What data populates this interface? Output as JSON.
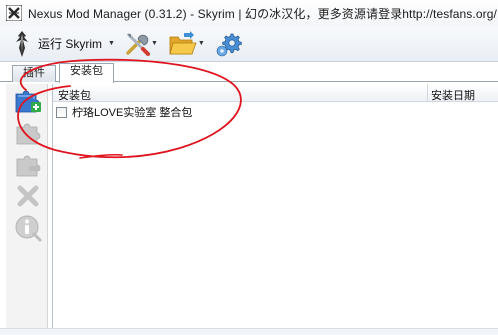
{
  "window": {
    "title": "Nexus Mod Manager (0.31.2) - Skyrim | 幻の冰汉化，更多资源请登录http://tesfans.org/"
  },
  "toolbar": {
    "game_label": "运行 Skyrim",
    "icons": [
      "skyrim-logo",
      "tools-icon",
      "folder-icon",
      "settings-icon"
    ]
  },
  "tabs": [
    {
      "label": "插件",
      "active": false
    },
    {
      "label": "安装包",
      "active": true
    }
  ],
  "actions": [
    "add-mod",
    "activate-mod",
    "deactivate-mod",
    "delete-mod",
    "mod-info"
  ],
  "list": {
    "columns": [
      "安装包",
      "安装日期"
    ],
    "rows": [
      {
        "name": "柠珞LOVE实验室 整合包",
        "checked": false,
        "date": ""
      }
    ]
  },
  "colors": {
    "annotation": "#e0141e",
    "toolbar_bg": "#edf1f6",
    "tab_border": "#9aa6b4"
  }
}
